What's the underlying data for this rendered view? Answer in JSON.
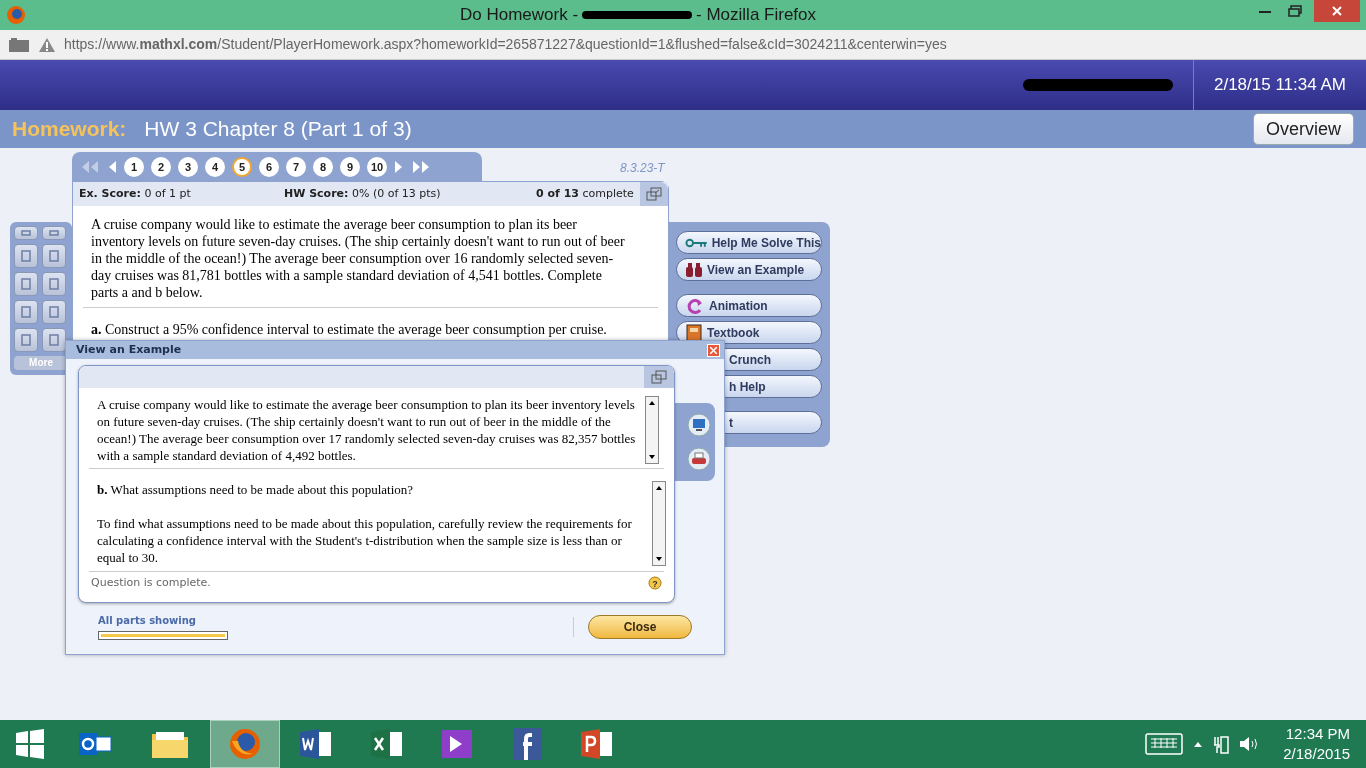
{
  "window": {
    "title_before": "Do Homework -",
    "title_after": "- Mozilla Firefox"
  },
  "address_bar": {
    "url": "https://www.**mathxl.com**/Student/PlayerHomework.aspx?homeworkId=265871227&questionId=1&flushed=false&cId=3024211&centerwin=yes"
  },
  "header": {
    "datetime": "2/18/15 11:34 AM"
  },
  "homework_bar": {
    "label": "Homework:",
    "title": "HW 3 Chapter 8 (Part 1 of 3)",
    "overview_button": "Overview"
  },
  "question_nav": {
    "questions": [
      {
        "label": "1",
        "selected": false
      },
      {
        "label": "2",
        "selected": false
      },
      {
        "label": "3",
        "selected": false
      },
      {
        "label": "4",
        "selected": false
      },
      {
        "label": "5",
        "selected": true
      },
      {
        "label": "6",
        "selected": false
      },
      {
        "label": "7",
        "selected": false
      },
      {
        "label": "8",
        "selected": false
      },
      {
        "label": "9",
        "selected": false
      },
      {
        "label": "10",
        "selected": false
      }
    ],
    "question_id": "8.3.23-T"
  },
  "score_bar": {
    "ex_score": "**Ex. Score:** 0 of 1 pt",
    "hw_score": "**HW Score:** 0% (0 of 13 pts)",
    "completion": "**0 of 13** complete"
  },
  "question": {
    "text": "A cruise company would like to estimate the average beer consumption to plan its beer inventory levels on future seven-day cruises. (The ship certainly doesn't want to run out of beer in the middle of the ocean!) The average beer consumption over 16 randomly selected seven-day cruises was 81,781 bottles with a sample standard deviation of 4,541 bottles. Complete parts a and b below.",
    "part_a": "**a.** Construct a 95% confidence interval to estimate the average beer consumption per cruise."
  },
  "left_palette": {
    "more_button": "More"
  },
  "help_panel": {
    "buttons": [
      {
        "label": "Help Me Solve This",
        "kind": "key"
      },
      {
        "label": "View an Example",
        "kind": "binoculars"
      },
      {
        "label": "Animation",
        "kind": "animation"
      },
      {
        "label": "Textbook",
        "kind": "book"
      },
      {
        "label": "Crunch",
        "kind": "covered"
      },
      {
        "label": "h Help",
        "kind": "covered"
      },
      {
        "label": "t",
        "kind": "covered"
      }
    ]
  },
  "dialog": {
    "title": "View an Example",
    "intro": "A cruise company would like to estimate the average beer consumption to plan its beer inventory levels on future seven-day cruises. (The ship certainly doesn't want to run out of beer in the middle of the ocean!) The average beer consumption over 17 randomly selected seven-day cruises was 82,357 bottles with a sample standard deviation of 4,492 bottles.",
    "part": "**b.** What assumptions need to be made about this population?",
    "hint": "To find what assumptions need to be made about this population, carefully review the requirements for calculating a confidence interval with the Student's t-distribution when the sample size is less than or equal to 30.",
    "status": "Question is complete.",
    "help_glyph": "?",
    "progress_label": "All parts showing",
    "progress": {
      "level": 1
    },
    "close_button": "Close"
  },
  "taskbar": {
    "apps": [
      {
        "kind": "start",
        "selected": false
      },
      {
        "kind": "outlook",
        "selected": false
      },
      {
        "kind": "folder",
        "selected": false
      },
      {
        "kind": "firefox",
        "selected": true
      },
      {
        "kind": "word",
        "selected": false
      },
      {
        "kind": "excel",
        "selected": false
      },
      {
        "kind": "video",
        "selected": false
      },
      {
        "kind": "facebook",
        "selected": false
      },
      {
        "kind": "powerpoint",
        "selected": false
      }
    ],
    "time": "12:34 PM",
    "date": "2/18/2015"
  }
}
